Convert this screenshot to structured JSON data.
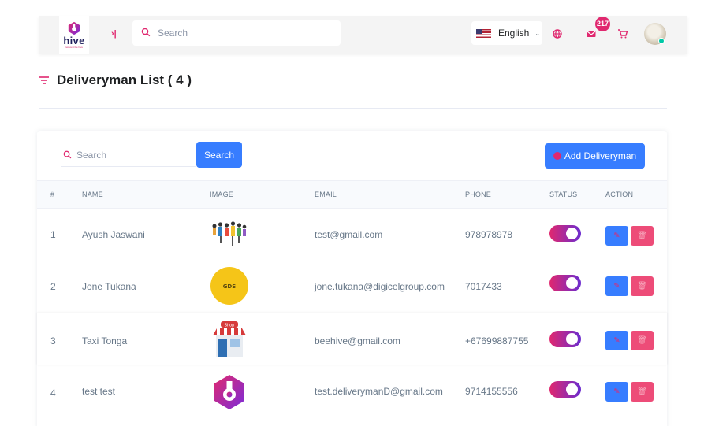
{
  "header": {
    "logo_text": "hive",
    "logo_tagline": "reinvent the hive",
    "sidebar_toggle_glyph": "›|",
    "search_placeholder": "Search",
    "language_label": "English",
    "language_flag_icon": "us-flag-icon",
    "icons": [
      "sidebar-toggle-icon",
      "search-icon",
      "globe-icon",
      "mail-icon",
      "cart-icon"
    ],
    "notification_count": "217",
    "accent_color": "#e0286f"
  },
  "page": {
    "title": "Deliveryman List ( 4 )"
  },
  "toolbar": {
    "search_placeholder": "Search",
    "search_button": "Search",
    "add_button": "Add Deliveryman",
    "primary_color": "#377dff"
  },
  "table": {
    "columns": [
      "#",
      "NAME",
      "IMAGE",
      "EMAIL",
      "PHONE",
      "STATUS",
      "ACTION"
    ],
    "rows": [
      {
        "num": "1",
        "name": "Ayush Jaswani",
        "image": "team-figures-image",
        "email": "test@gmail.com",
        "phone": "978978978",
        "status": "on"
      },
      {
        "num": "2",
        "name": "Jone Tukana",
        "image": "gds-logo-image",
        "image_text": "GDS",
        "email": "jone.tukana@digicelgroup.com",
        "phone": "7017433",
        "status": "on"
      },
      {
        "num": "3",
        "name": "Taxi Tonga",
        "image": "shop-storefront-image",
        "image_text": "Shop",
        "email": "beehive@gmail.com",
        "phone": "+67699887755",
        "status": "on"
      },
      {
        "num": "4",
        "name": "test test",
        "image": "hive-logo-image",
        "email": "test.deliverymanD@gmail.com",
        "phone": "9714155556",
        "status": "on"
      }
    ]
  }
}
